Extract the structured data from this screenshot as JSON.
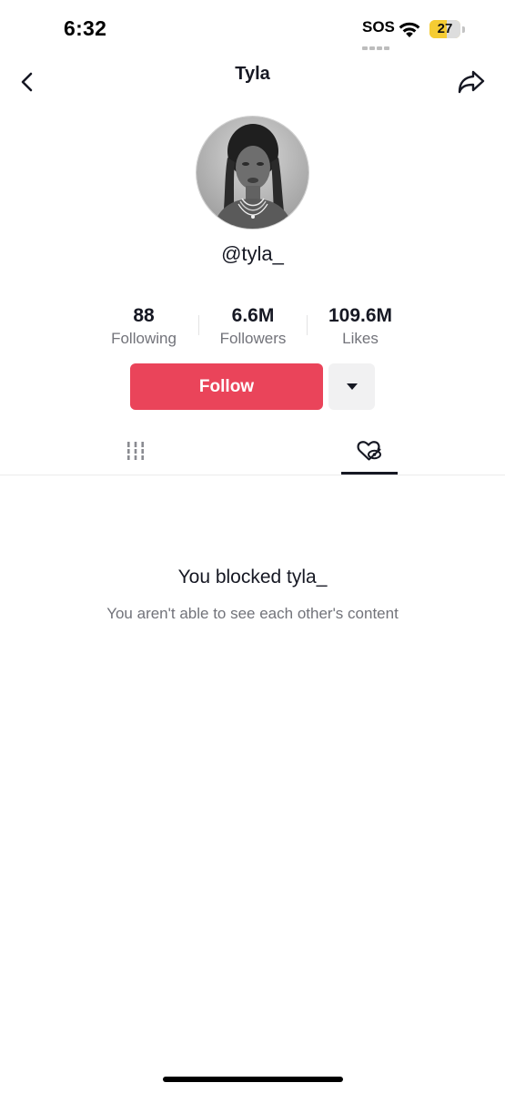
{
  "status_bar": {
    "time": "6:32",
    "sos": "SOS",
    "battery": "27",
    "battery_level": 0.27
  },
  "header": {
    "title": "Tyla",
    "back_icon": "chevron-left-icon",
    "share_icon": "share-arrow-icon"
  },
  "profile": {
    "username": "@tyla_",
    "avatar": "profile-photo"
  },
  "stats": [
    {
      "value": "88",
      "label": "Following"
    },
    {
      "value": "6.6M",
      "label": "Followers"
    },
    {
      "value": "109.6M",
      "label": "Likes"
    }
  ],
  "actions": {
    "follow_label": "Follow",
    "follow_color": "#ea445a",
    "more_icon": "caret-down-icon"
  },
  "tabs": [
    {
      "icon": "videos-grid-icon",
      "active": false
    },
    {
      "icon": "liked-hidden-icon",
      "active": true
    }
  ],
  "blocked": {
    "title": "You blocked tyla_",
    "subtitle": "You aren't able to see each other's content"
  }
}
